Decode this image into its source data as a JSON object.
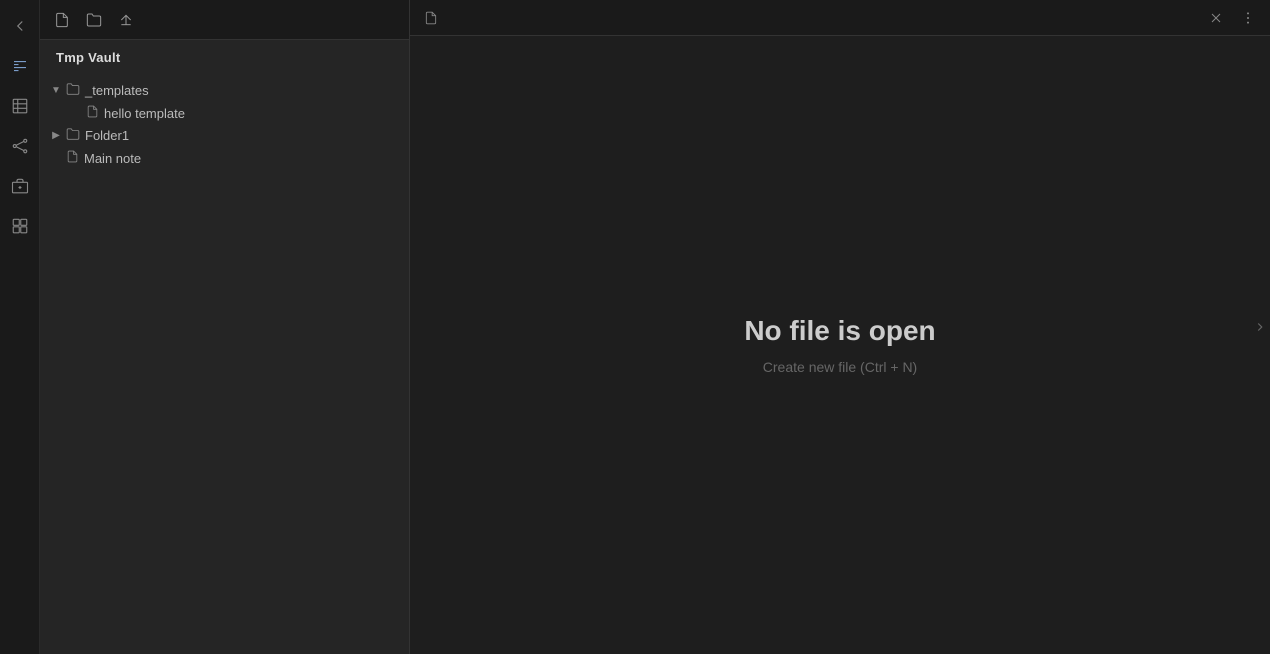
{
  "rail": {
    "icons": [
      {
        "name": "back-icon",
        "label": "<"
      },
      {
        "name": "template-icon",
        "label": "template"
      },
      {
        "name": "table-icon",
        "label": "table"
      },
      {
        "name": "graph-icon",
        "label": "graph"
      },
      {
        "name": "archive-icon",
        "label": "archive"
      },
      {
        "name": "plugin-icon",
        "label": "plugin"
      }
    ]
  },
  "explorer": {
    "vault_name": "Tmp Vault",
    "toolbar": {
      "new_file_label": "New file",
      "new_folder_label": "New folder",
      "sort_label": "Sort"
    },
    "tree": [
      {
        "id": "templates-folder",
        "label": "_templates",
        "type": "folder",
        "expanded": true,
        "children": [
          {
            "id": "hello-template",
            "label": "hello template",
            "type": "file"
          }
        ]
      },
      {
        "id": "folder1",
        "label": "Folder1",
        "type": "folder",
        "expanded": false,
        "children": []
      },
      {
        "id": "main-note",
        "label": "Main note",
        "type": "file"
      }
    ]
  },
  "editor": {
    "tab_icon_label": "file",
    "no_file_title": "No file is open",
    "no_file_subtitle": "Create new file (Ctrl + N)"
  }
}
